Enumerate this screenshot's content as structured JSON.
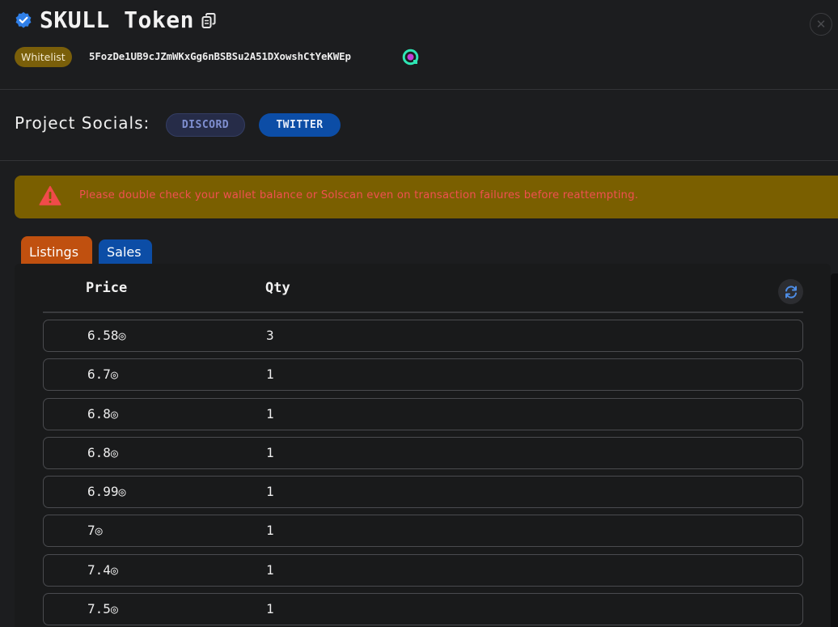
{
  "header": {
    "title": "SKULL Token",
    "badge": "Whitelist",
    "mint_address": "5FozDe1UB9cJZmWKxGg6nBSBSu2A51DXowshCtYeKWEp",
    "close_label": "✕"
  },
  "socials": {
    "label": "Project Socials:",
    "links": [
      "DISCORD",
      "TWITTER"
    ]
  },
  "warning": {
    "text": "Please double check your wallet balance or Solscan even on transaction failures before reattempting."
  },
  "tabs": [
    "Listings",
    "Sales"
  ],
  "table": {
    "columns": [
      "Price",
      "Qty"
    ],
    "currency_symbol": "◎",
    "rows": [
      {
        "price": "6.58",
        "qty": "3"
      },
      {
        "price": "6.7",
        "qty": "1"
      },
      {
        "price": "6.8",
        "qty": "1"
      },
      {
        "price": "6.8",
        "qty": "1"
      },
      {
        "price": "6.99",
        "qty": "1"
      },
      {
        "price": "7",
        "qty": "1"
      },
      {
        "price": "7.4",
        "qty": "1"
      },
      {
        "price": "7.5",
        "qty": "1"
      }
    ]
  },
  "icons": {
    "verified": "verified-badge-icon",
    "copy": "copy-icon",
    "explorer": "explorer-link-icon",
    "warning": "warning-triangle-icon",
    "refresh": "refresh-icon"
  },
  "colors": {
    "background": "#1c1d1f",
    "whitelist_badge": "#7a5f0a",
    "warning_bg": "#7a5f00",
    "warning_text": "#f05050",
    "listings_tab": "#c0500f",
    "sales_tab": "#0c4da6",
    "twitter": "#0c4da6",
    "discord": "#262c48"
  }
}
